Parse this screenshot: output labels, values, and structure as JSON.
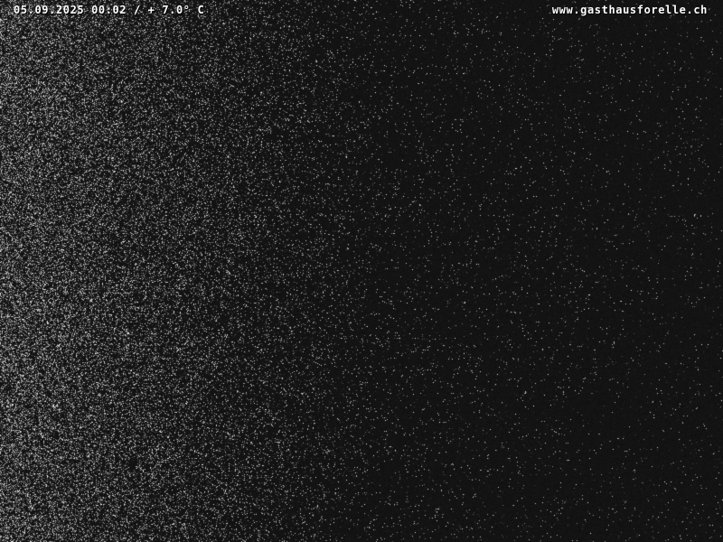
{
  "overlay": {
    "timestamp_temperature": "05.09.2025 00:02 / + 7.0° C",
    "website": "www.gasthausforelle.ch"
  },
  "scene": {
    "description_type": "night webcam frame with sensor noise",
    "background_color": "#121212",
    "noise_color": "#d8d8d8",
    "text_color": "#ffffff"
  }
}
